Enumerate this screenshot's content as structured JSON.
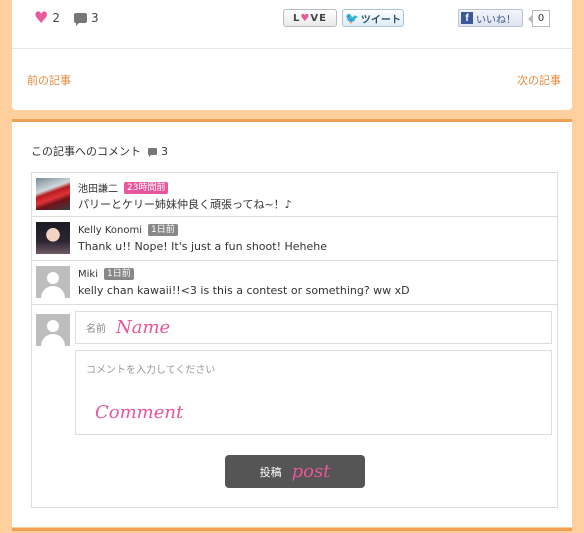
{
  "stats": {
    "love_count": "2",
    "comment_count": "3"
  },
  "share": {
    "love_label": "L♥VE",
    "tweet_label": "ツイート",
    "like_label": "いいね！",
    "like_count": "0"
  },
  "nav": {
    "prev_label": "前の記事",
    "next_label": "次の記事"
  },
  "comments": {
    "heading": "この記事へのコメント",
    "count": "3",
    "items": [
      {
        "author": "池田謙二",
        "time": "23時間前",
        "time_color": "#e8559a",
        "text": "パリーとケリー姉妹仲良く頑張ってね~！♪",
        "avatar": "car-photo"
      },
      {
        "author": "Kelly Konomi",
        "time": "1日前",
        "time_color": "#888888",
        "text": "Thank u!! Nope! It's just a fun shoot! Hehehe",
        "avatar": "girl-photo"
      },
      {
        "author": "Miki",
        "time": "1日前",
        "time_color": "#888888",
        "text": "kelly chan kawaii!!<3 is this a contest or something? ww xD",
        "avatar": "default-user"
      }
    ]
  },
  "form": {
    "name_label": "名前",
    "name_annotation": "Name",
    "comment_placeholder": "コメントを入力してください",
    "comment_annotation": "Comment",
    "post_label": "投稿",
    "post_annotation": "post"
  },
  "colors": {
    "accent": "#f0a050",
    "pink": "#e8559a",
    "background": "#ffcf9e"
  }
}
